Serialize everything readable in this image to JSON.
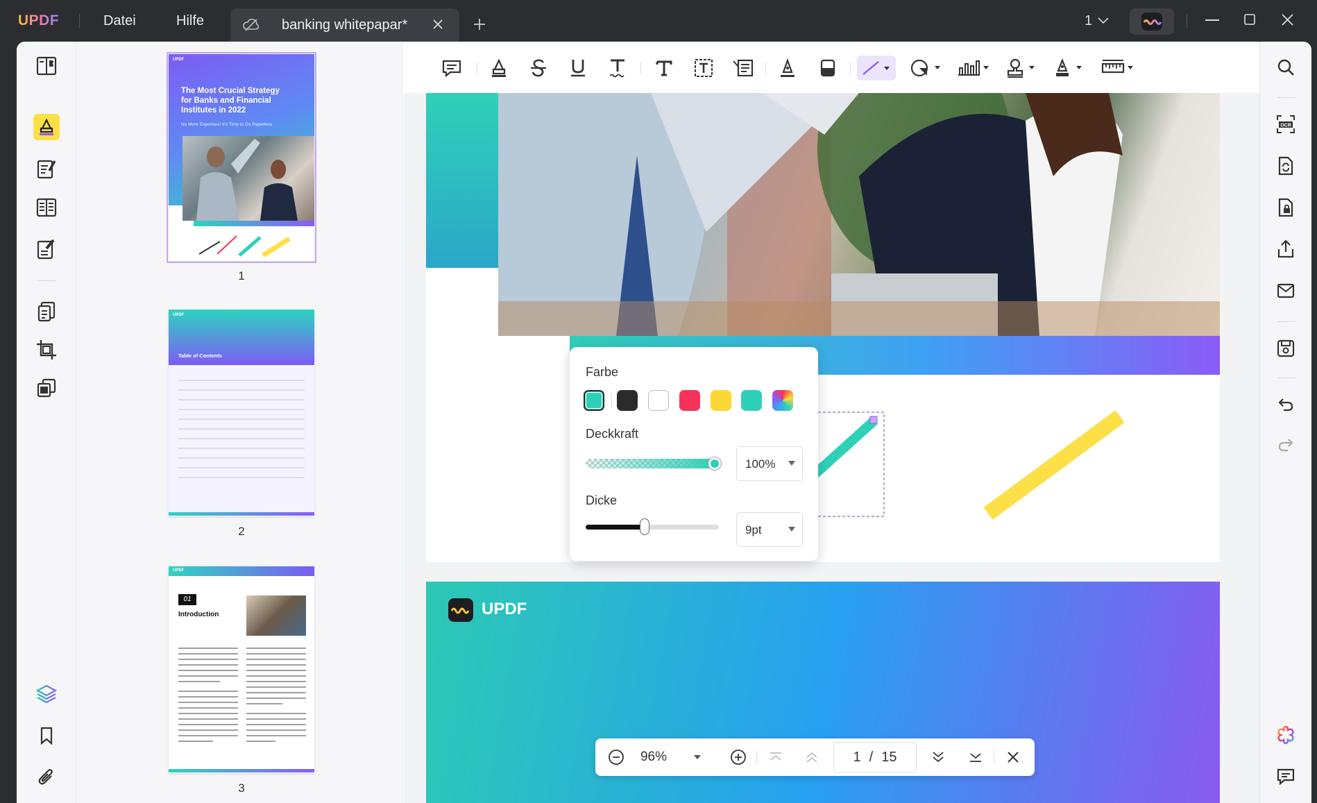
{
  "app": {
    "logo": "UPDF",
    "brand_colors": {
      "accent": "#8b5cf6",
      "teal": "#2fd0b8",
      "window": "#2c2d31"
    }
  },
  "menu": {
    "file": "Datei",
    "help": "Hilfe"
  },
  "tab": {
    "title": "banking whitepapar*"
  },
  "window_controls": {
    "page_count_indicator": "1"
  },
  "left_sidebar": {
    "items": [
      {
        "icon": "reader-icon"
      },
      {
        "icon": "comment-highlighter-icon",
        "active": true
      },
      {
        "icon": "edit-pdf-icon"
      },
      {
        "icon": "page-layout-icon"
      },
      {
        "icon": "form-edit-icon"
      },
      {
        "icon": "organize-pages-icon"
      },
      {
        "icon": "crop-icon"
      },
      {
        "icon": "copy-pages-icon"
      },
      {
        "icon": "layers-icon"
      },
      {
        "icon": "bookmark-icon"
      },
      {
        "icon": "attachment-icon"
      }
    ]
  },
  "thumbnails": [
    {
      "number": "1",
      "title": "The Most Crucial Strategy for Banks and Financial Institutes in 2022",
      "subtitle": "No More Expenses! It's Time to Go Paperless",
      "brand": "UPDF"
    },
    {
      "number": "2",
      "heading": "Table of Contents",
      "brand": "UPDF"
    },
    {
      "number": "3",
      "chapter": "01",
      "heading": "Introduction",
      "brand": "UPDF"
    }
  ],
  "toolbar": {
    "tools": [
      "sticky-note-icon",
      "highlight-icon",
      "strikethrough-icon",
      "underline-icon",
      "squiggly-icon",
      "text-icon",
      "textbox-icon",
      "text-callout-icon",
      "pencil-icon",
      "eraser-icon",
      "line-icon",
      "shape-icon",
      "chart-icon",
      "stamp-icon",
      "signature-icon",
      "measure-icon"
    ]
  },
  "popup": {
    "color_label": "Farbe",
    "opacity_label": "Deckkraft",
    "opacity_value": "100%",
    "opacity_level": 1.0,
    "thickness_label": "Dicke",
    "thickness_value": "9pt",
    "thickness_level": 0.45,
    "colors": [
      "#2fd0b8",
      "#2b2b2b",
      "#ffffff",
      "#f5335a",
      "#fdd835",
      "#2fd0b8",
      "rainbow"
    ],
    "selected_color": "#2fd0b8"
  },
  "page2": {
    "brand": "UPDF"
  },
  "zoombar": {
    "zoom": "96%",
    "current_page": "1",
    "separator": "/",
    "total_pages": "15"
  },
  "right_sidebar": {
    "items": [
      "search-icon",
      "ocr-icon",
      "convert-icon",
      "protect-icon",
      "share-icon",
      "email-icon",
      "save-icon",
      "undo-icon",
      "redo-icon",
      "ai-assistant-icon",
      "comments-icon"
    ]
  }
}
